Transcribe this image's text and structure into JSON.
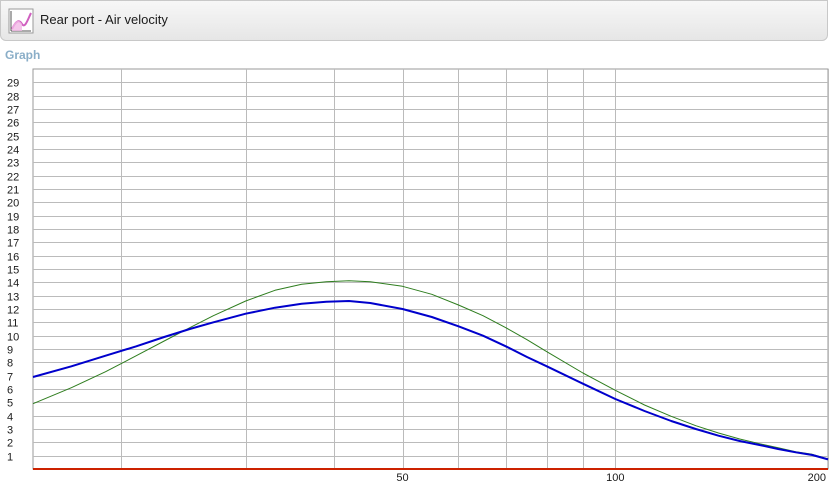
{
  "window": {
    "title": "Rear port - Air velocity",
    "title_icon": "line-chart-icon"
  },
  "section": {
    "label": "Graph"
  },
  "colors": {
    "series_green": "#2e7d1e",
    "series_blue": "#0000cc",
    "baseline_red": "#cc2200",
    "grid": "#bbbbbb",
    "label_accent": "#8aaec8"
  },
  "chart_data": {
    "type": "line",
    "title": "",
    "xlabel": "",
    "ylabel": "",
    "x_scale": "log",
    "xlim": [
      15,
      200
    ],
    "ylim": [
      0,
      30
    ],
    "grid": true,
    "legend": "none",
    "x_ticks": [
      {
        "value": 50,
        "label": "50"
      },
      {
        "value": 100,
        "label": "100"
      },
      {
        "value": 200,
        "label": "200"
      }
    ],
    "y_ticks": [
      1,
      2,
      3,
      4,
      5,
      6,
      7,
      8,
      9,
      10,
      11,
      12,
      13,
      14,
      15,
      16,
      17,
      18,
      19,
      20,
      21,
      22,
      23,
      24,
      25,
      26,
      27,
      28,
      29
    ],
    "series": [
      {
        "color": "#2e7d1e",
        "line_width": 1,
        "points": [
          [
            15,
            4.9
          ],
          [
            17,
            6.1
          ],
          [
            19,
            7.3
          ],
          [
            21,
            8.5
          ],
          [
            23,
            9.6
          ],
          [
            25,
            10.6
          ],
          [
            27,
            11.5
          ],
          [
            30,
            12.6
          ],
          [
            33,
            13.4
          ],
          [
            36,
            13.85
          ],
          [
            39,
            14.05
          ],
          [
            42,
            14.12
          ],
          [
            45,
            14.05
          ],
          [
            50,
            13.7
          ],
          [
            55,
            13.1
          ],
          [
            60,
            12.3
          ],
          [
            65,
            11.5
          ],
          [
            70,
            10.6
          ],
          [
            75,
            9.7
          ],
          [
            80,
            8.8
          ],
          [
            90,
            7.2
          ],
          [
            100,
            5.9
          ],
          [
            110,
            4.8
          ],
          [
            120,
            3.95
          ],
          [
            130,
            3.25
          ],
          [
            140,
            2.7
          ],
          [
            150,
            2.25
          ],
          [
            160,
            1.9
          ],
          [
            170,
            1.6
          ],
          [
            180,
            1.3
          ],
          [
            190,
            1.1
          ],
          [
            200,
            0.75
          ]
        ]
      },
      {
        "color": "#0000cc",
        "line_width": 2,
        "points": [
          [
            15,
            6.9
          ],
          [
            17,
            7.7
          ],
          [
            19,
            8.5
          ],
          [
            21,
            9.2
          ],
          [
            23,
            9.9
          ],
          [
            25,
            10.5
          ],
          [
            27,
            11.0
          ],
          [
            30,
            11.65
          ],
          [
            33,
            12.1
          ],
          [
            36,
            12.4
          ],
          [
            39,
            12.55
          ],
          [
            42,
            12.6
          ],
          [
            45,
            12.45
          ],
          [
            50,
            12.0
          ],
          [
            55,
            11.4
          ],
          [
            60,
            10.7
          ],
          [
            65,
            10.0
          ],
          [
            70,
            9.2
          ],
          [
            75,
            8.4
          ],
          [
            80,
            7.7
          ],
          [
            90,
            6.4
          ],
          [
            100,
            5.25
          ],
          [
            110,
            4.35
          ],
          [
            120,
            3.6
          ],
          [
            130,
            3.0
          ],
          [
            140,
            2.5
          ],
          [
            150,
            2.1
          ],
          [
            160,
            1.8
          ],
          [
            170,
            1.5
          ],
          [
            180,
            1.25
          ],
          [
            190,
            1.05
          ],
          [
            200,
            0.72
          ]
        ]
      }
    ]
  }
}
